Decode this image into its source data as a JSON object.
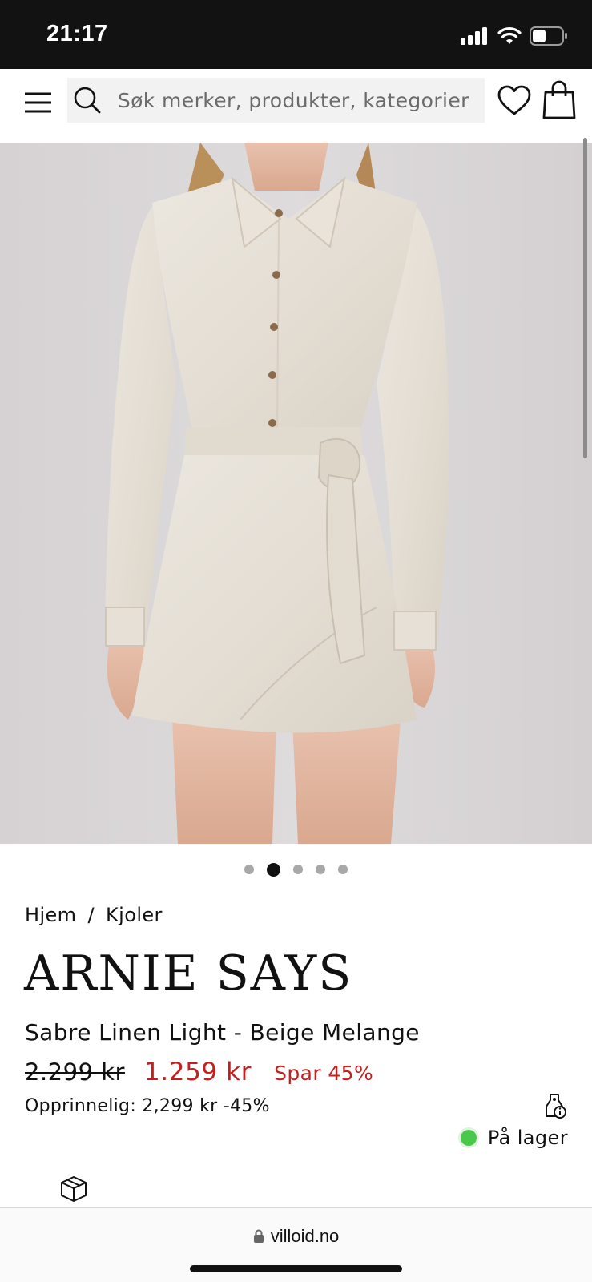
{
  "status_bar": {
    "time": "21:17",
    "icons": [
      "cellular-signal-icon",
      "wifi-icon",
      "battery-icon"
    ]
  },
  "header": {
    "menu_icon": "hamburger-menu-icon",
    "search_placeholder": "Søk merker, produkter, kategorier",
    "search_icon": "search-icon",
    "wishlist_icon": "heart-icon",
    "cart_icon": "shopping-bag-icon"
  },
  "gallery": {
    "image_subject": "beige linen wrap shirt dress",
    "dot_count": 5,
    "active_index": 1
  },
  "product": {
    "breadcrumb": {
      "home": "Hjem",
      "separator": "/",
      "category": "Kjoler"
    },
    "brand": "ARNIE SAYS",
    "name": "Sabre Linen Light - Beige Melange",
    "price_original": "2.299 kr",
    "price_sale": "1.259 kr",
    "discount_label": "Spar 45%",
    "original_text": "Opprinnelig: 2,299 kr -45%",
    "stock_status": "På lager",
    "colors": {
      "sale": "#c41e1e",
      "in_stock": "#49c84a"
    }
  },
  "browser": {
    "url": "villoid.no",
    "lock_icon": "lock-icon"
  }
}
